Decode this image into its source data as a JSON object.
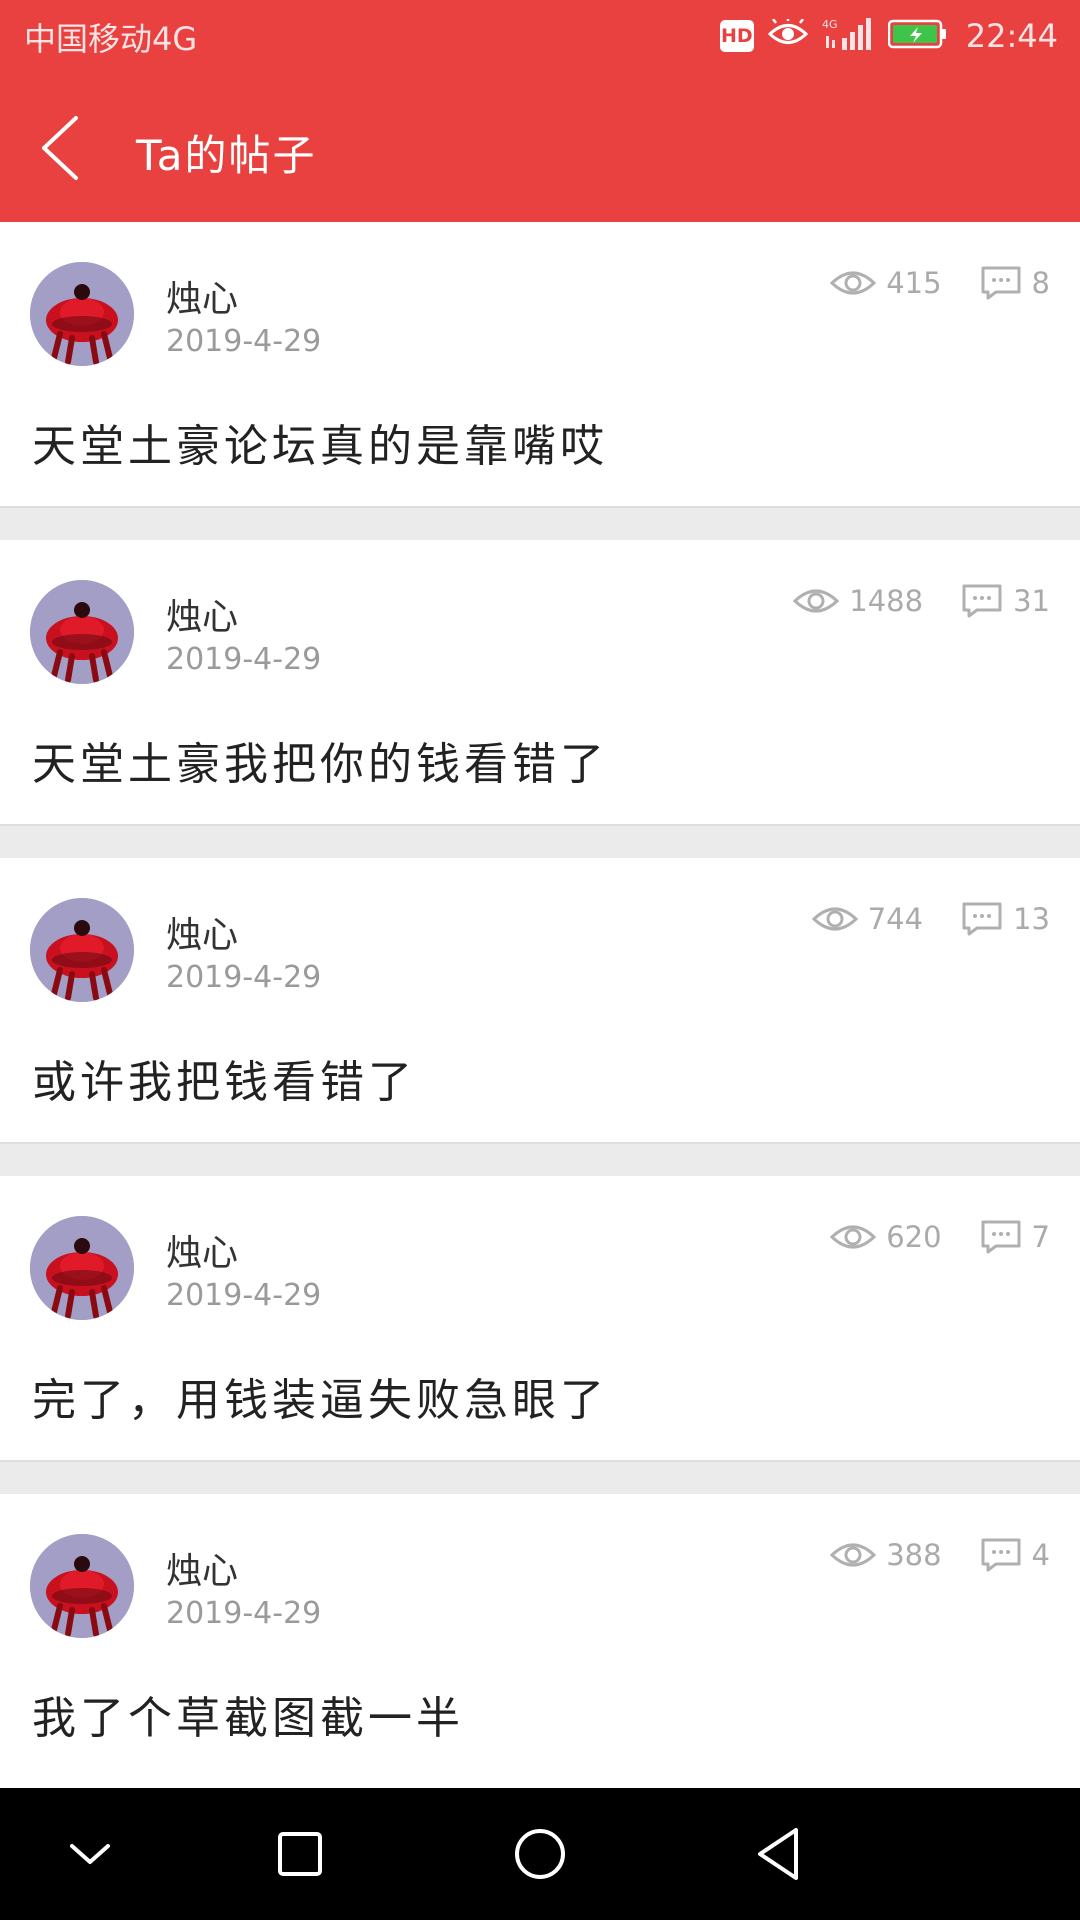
{
  "status_bar": {
    "carrier": "中国移动4G",
    "hd": "HD",
    "time": "22:44"
  },
  "app_bar": {
    "title": "Ta的帖子"
  },
  "posts": [
    {
      "author": "烛心",
      "date": "2019-4-29",
      "views": "415",
      "comments": "8",
      "title": "天堂土豪论坛真的是靠嘴哎"
    },
    {
      "author": "烛心",
      "date": "2019-4-29",
      "views": "1488",
      "comments": "31",
      "title": "天堂土豪我把你的钱看错了"
    },
    {
      "author": "烛心",
      "date": "2019-4-29",
      "views": "744",
      "comments": "13",
      "title": "或许我把钱看错了"
    },
    {
      "author": "烛心",
      "date": "2019-4-29",
      "views": "620",
      "comments": "7",
      "title": "完了，用钱装逼失败急眼了"
    },
    {
      "author": "烛心",
      "date": "2019-4-29",
      "views": "388",
      "comments": "4",
      "title": "我了个草截图截一半"
    }
  ],
  "icons": {
    "back": "chevron-left-icon",
    "views": "eye-icon",
    "comments": "comment-icon",
    "nav": [
      "chevron-down-icon",
      "square-icon",
      "circle-icon",
      "triangle-back-icon"
    ]
  },
  "colors": {
    "header": "#e94040",
    "background": "#ebebeb",
    "card": "#ffffff",
    "nav_bar": "#000000",
    "meta_text": "#9a9a9a"
  }
}
